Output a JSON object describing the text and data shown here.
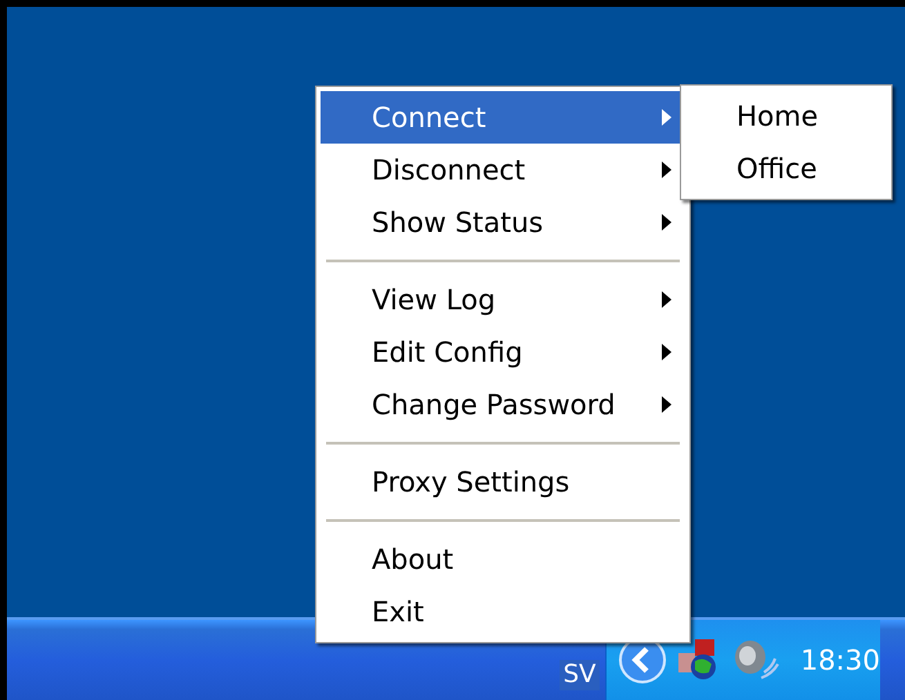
{
  "menu": {
    "groups": [
      [
        {
          "label": "Connect",
          "has_submenu": true,
          "selected": true
        },
        {
          "label": "Disconnect",
          "has_submenu": true,
          "selected": false
        },
        {
          "label": "Show Status",
          "has_submenu": true,
          "selected": false
        }
      ],
      [
        {
          "label": "View Log",
          "has_submenu": true,
          "selected": false
        },
        {
          "label": "Edit Config",
          "has_submenu": true,
          "selected": false
        },
        {
          "label": "Change Password",
          "has_submenu": true,
          "selected": false
        }
      ],
      [
        {
          "label": "Proxy Settings",
          "has_submenu": false,
          "selected": false
        }
      ],
      [
        {
          "label": "About",
          "has_submenu": false,
          "selected": false
        },
        {
          "label": "Exit",
          "has_submenu": false,
          "selected": false
        }
      ]
    ]
  },
  "submenu": {
    "items": [
      {
        "label": "Home",
        "selected": false
      },
      {
        "label": "Office",
        "selected": false
      }
    ]
  },
  "taskbar": {
    "language": "SV",
    "clock": "18:30"
  }
}
